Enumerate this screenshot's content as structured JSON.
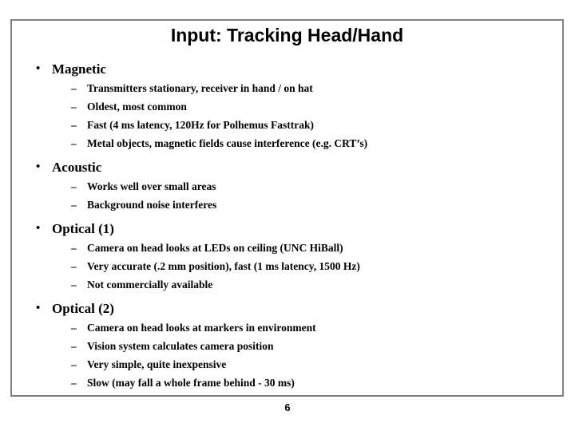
{
  "slide": {
    "title": "Input: Tracking Head/Hand",
    "page_number": "6",
    "bullet_glyph": "•",
    "dash_glyph": "–",
    "border_color": "#808080",
    "text_color": "#000000",
    "background_color": "#ffffff",
    "groups": [
      {
        "heading": "Magnetic",
        "items": [
          "Transmitters stationary, receiver in hand / on hat",
          "Oldest, most common",
          "Fast (4 ms latency, 120Hz for Polhemus Fasttrak)",
          "Metal objects, magnetic fields cause interference (e.g. CRT’s)"
        ]
      },
      {
        "heading": "Acoustic",
        "items": [
          "Works well over small areas",
          "Background noise interferes"
        ]
      },
      {
        "heading": "Optical (1)",
        "items": [
          "Camera on head looks at LEDs on ceiling (UNC HiBall)",
          "Very accurate (.2 mm position), fast (1 ms latency, 1500 Hz)",
          "Not commercially available"
        ]
      },
      {
        "heading": "Optical (2)",
        "items": [
          "Camera on head looks at markers in environment",
          "Vision system calculates camera position",
          "Very simple, quite inexpensive",
          "Slow (may fall a whole frame behind - 30 ms)"
        ]
      }
    ]
  }
}
